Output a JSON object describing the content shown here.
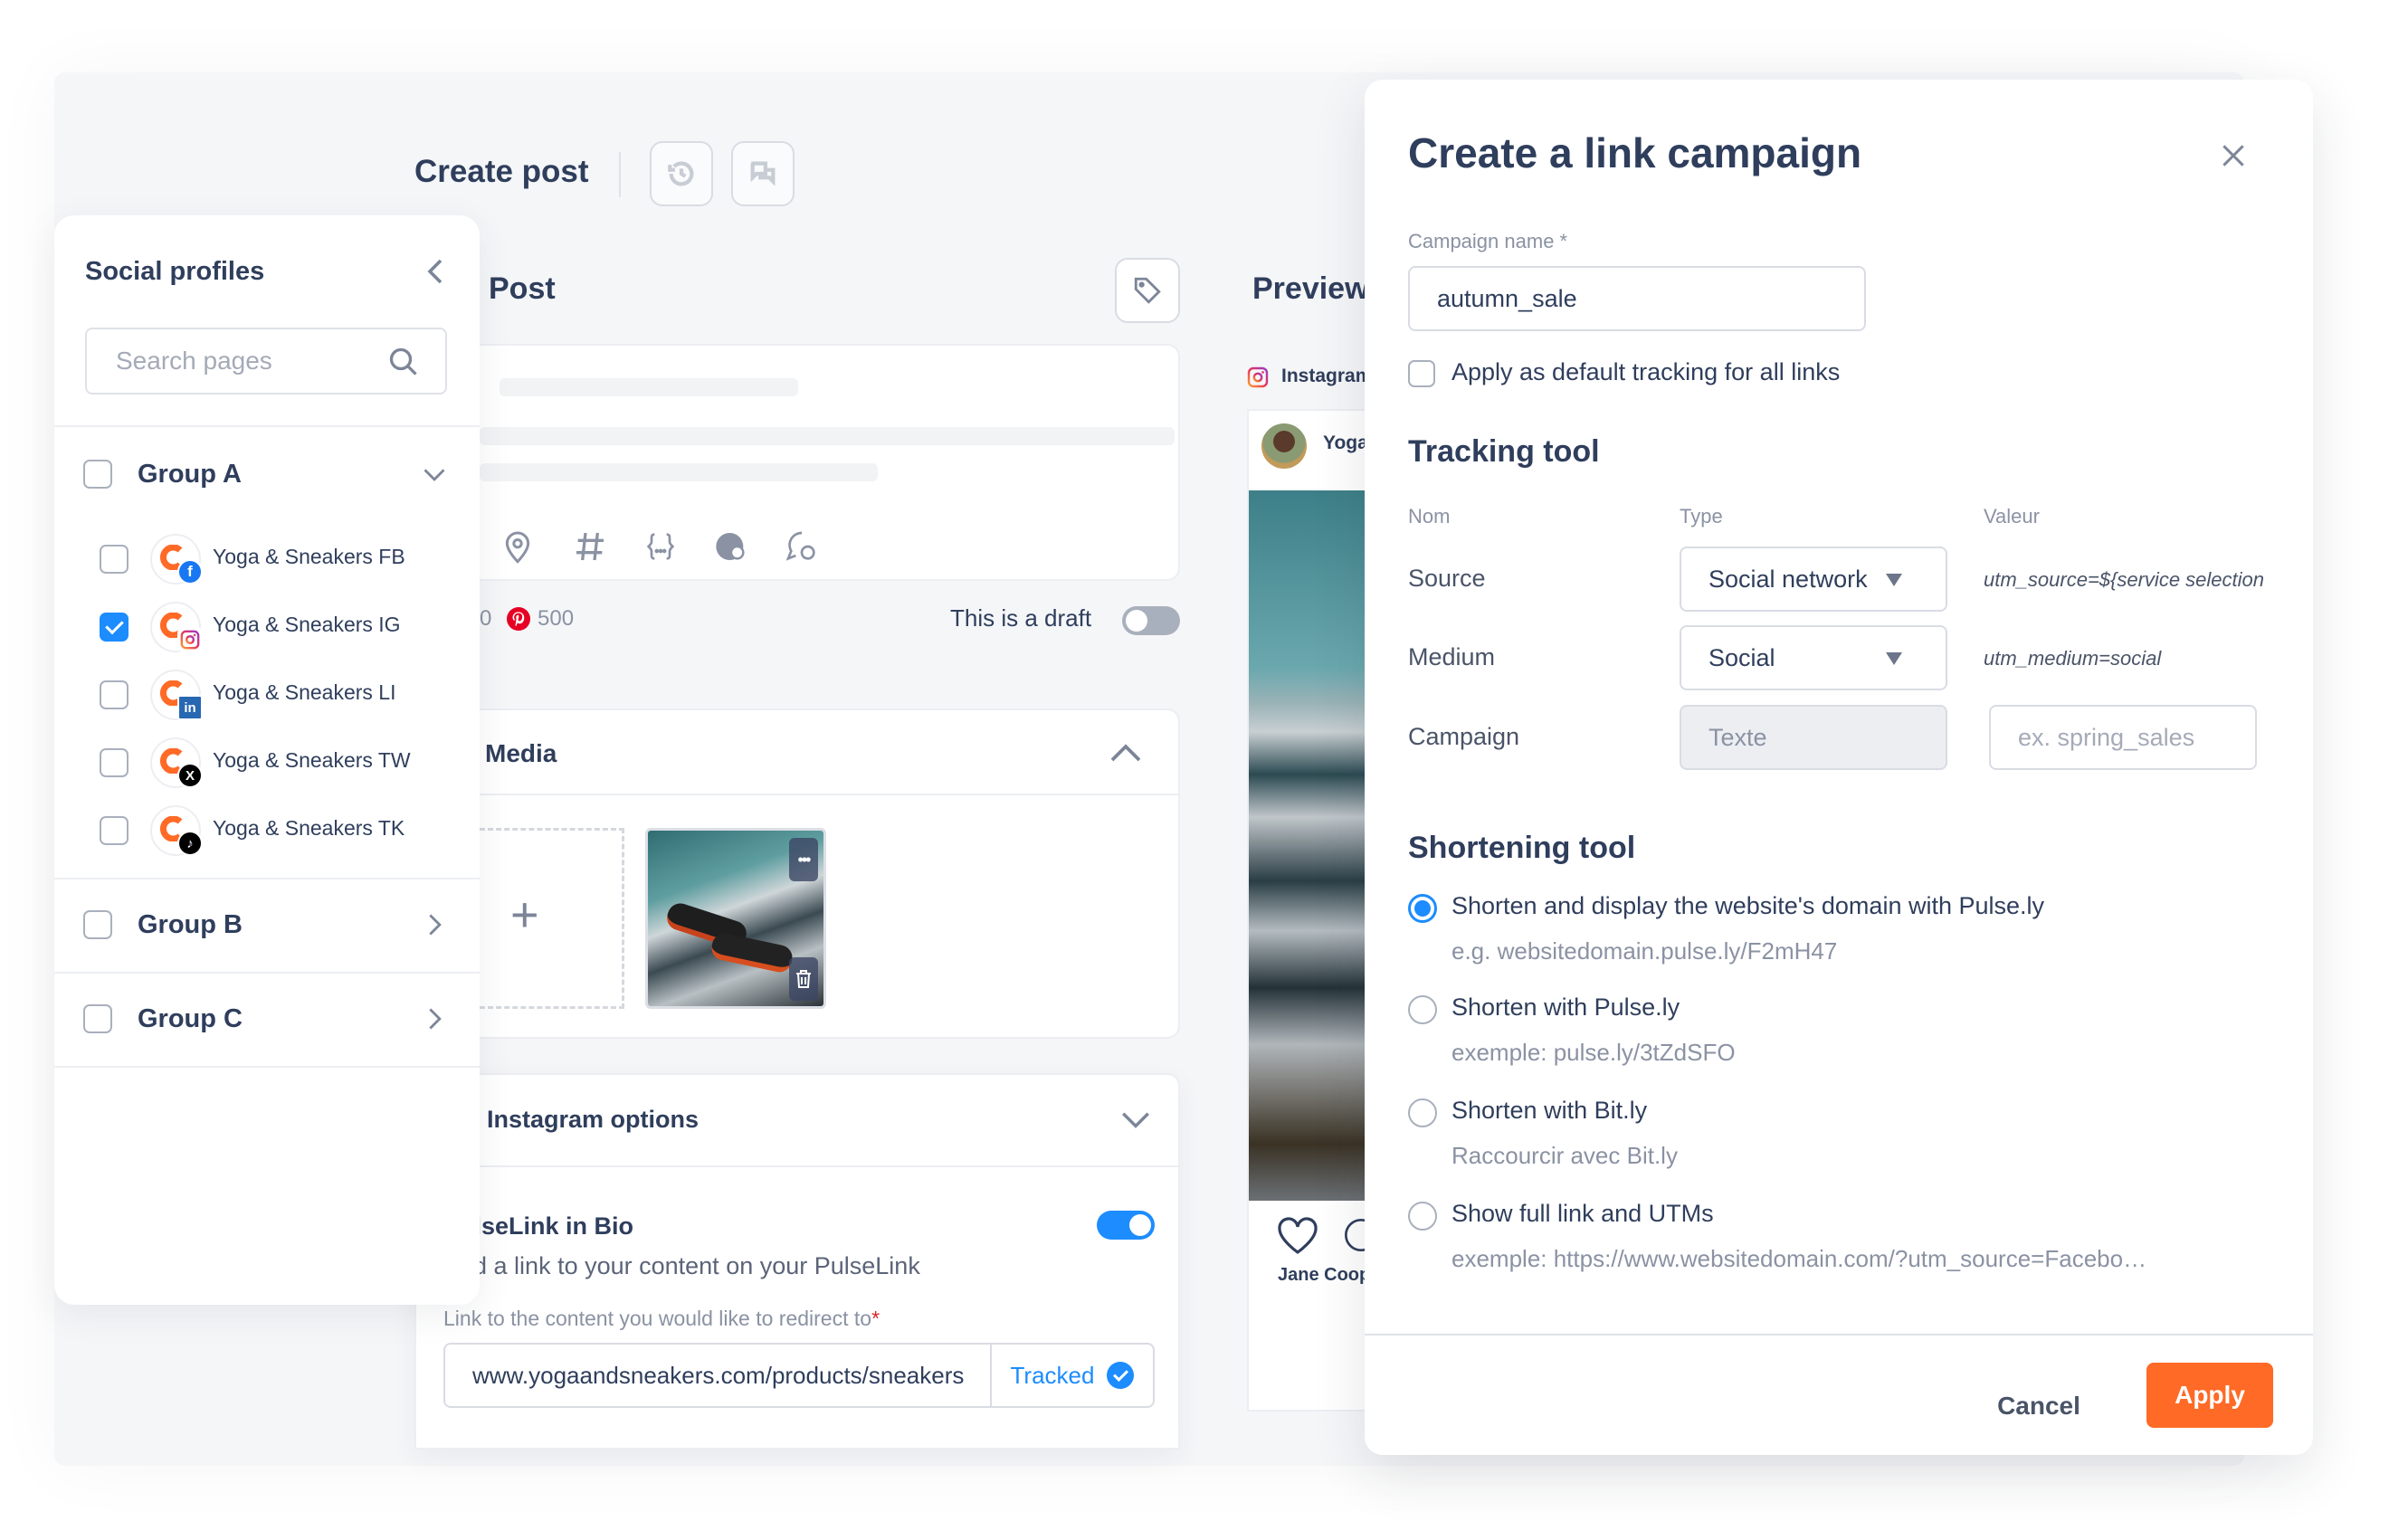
{
  "header": {
    "title": "Create post",
    "history_icon": "history-icon",
    "comments_icon": "comments-icon"
  },
  "social_profiles": {
    "title": "Social profiles",
    "search_placeholder": "Search pages",
    "groups": [
      {
        "label": "Group A",
        "checked": false,
        "expanded": true,
        "profiles": [
          {
            "label": "Yoga & Sneakers FB",
            "network": "facebook",
            "checked": false
          },
          {
            "label": "Yoga & Sneakers IG",
            "network": "instagram",
            "checked": true
          },
          {
            "label": "Yoga & Sneakers LI",
            "network": "linkedin",
            "checked": false
          },
          {
            "label": "Yoga & Sneakers TW",
            "network": "x",
            "checked": false
          },
          {
            "label": "Yoga & Sneakers TK",
            "network": "tiktok",
            "checked": false
          }
        ]
      },
      {
        "label": "Group B",
        "checked": false,
        "expanded": false
      },
      {
        "label": "Group C",
        "checked": false,
        "expanded": false
      }
    ]
  },
  "post": {
    "title": "Post",
    "char_count_partial": "0",
    "pinterest_limit": "500",
    "draft_label": "This is a draft",
    "draft_on": false,
    "toolbar_icons": [
      "location-icon",
      "hashtag-icon",
      "variables-icon",
      "globe-icon",
      "comment-icon"
    ]
  },
  "media": {
    "title": "Media",
    "add_label": "+",
    "more_label": "•••"
  },
  "instagram_options": {
    "title": "Instagram options",
    "pulselink_title": "PulseLink in Bio",
    "pulselink_on": true,
    "pulselink_desc": "Add a link to your content on your PulseLink",
    "link_label": "Link to the content you would like to redirect to",
    "link_required_mark": "*",
    "link_value": "www.yogaandsneakers.com/products/sneakers",
    "tracked_label": "Tracked"
  },
  "preview": {
    "title": "Preview",
    "network_label": "Instagram",
    "account_name": "Yoga",
    "footer_name": "Jane Coop"
  },
  "modal": {
    "title": "Create a link campaign",
    "campaign_name_label": "Campaign name *",
    "campaign_name_value": "autumn_sale",
    "default_tracking_label": "Apply as default tracking for all links",
    "default_tracking_checked": false,
    "tracking_title": "Tracking tool",
    "columns": [
      "Nom",
      "Type",
      "Valeur"
    ],
    "rows": [
      {
        "name": "Source",
        "type": "Social network",
        "value": "utm_source=${service selection"
      },
      {
        "name": "Medium",
        "type": "Social",
        "value": "utm_medium=social"
      },
      {
        "name": "Campaign",
        "type_placeholder": "Texte",
        "value_placeholder": "ex. spring_sales"
      }
    ],
    "shortening_title": "Shortening tool",
    "shortening_options": [
      {
        "label": "Shorten and display the website's domain with Pulse.ly",
        "hint": "e.g. websitedomain.pulse.ly/F2mH47",
        "selected": true
      },
      {
        "label": "Shorten with Pulse.ly",
        "hint": "exemple: pulse.ly/3tZdSFO",
        "selected": false
      },
      {
        "label": "Shorten with Bit.ly",
        "hint": "Raccourcir avec Bit.ly",
        "selected": false
      },
      {
        "label": "Show full link and UTMs",
        "hint": "exemple: https://www.websitedomain.com/?utm_source=Facebo…",
        "selected": false
      }
    ],
    "cancel_label": "Cancel",
    "apply_label": "Apply"
  },
  "colors": {
    "accent_blue": "#1c8cff",
    "apply_orange": "#ff6a26",
    "text_primary": "#2f3e5c",
    "text_muted": "#8a92a3"
  }
}
